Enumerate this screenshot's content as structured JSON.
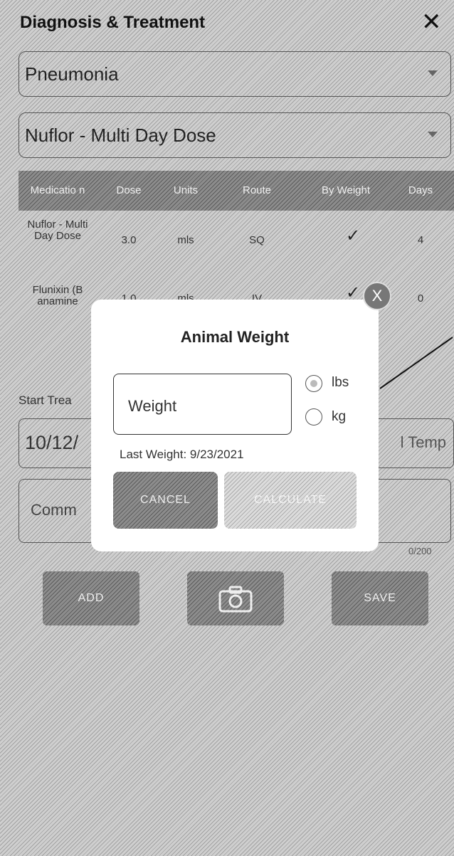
{
  "header": {
    "title": "Diagnosis & Treatment",
    "close_glyph": "✕"
  },
  "diagnosis_select": {
    "value": "Pneumonia"
  },
  "medication_select": {
    "value": "Nuflor - Multi Day Dose"
  },
  "table": {
    "headers": [
      "Medicatio n",
      "Dose",
      "Units",
      "Route",
      "By Weight",
      "Days"
    ],
    "rows": [
      {
        "medication": "Nuflor - Multi Day Dose",
        "dose": "3.0",
        "units": "mls",
        "route": "SQ",
        "by_weight": "✓",
        "days": "4"
      },
      {
        "medication": "Flunixin (B anamine",
        "dose": "1.0",
        "units": "mls",
        "route": "IV",
        "by_weight": "✓",
        "days": "0"
      }
    ]
  },
  "background": {
    "start_label": "Start Trea",
    "date_value": "10/12/",
    "temp_placeholder": "l Temp",
    "comment_placeholder": "Comm",
    "char_count": "0/200",
    "add_button": "ADD",
    "save_button": "SAVE"
  },
  "modal": {
    "title": "Animal Weight",
    "weight_placeholder": "Weight",
    "unit_options": [
      "lbs",
      "kg"
    ],
    "selected_unit": "lbs",
    "last_weight": "Last Weight: 9/23/2021",
    "cancel_label": "CANCEL",
    "calculate_label": "CALCULATE",
    "close_glyph": "X"
  }
}
